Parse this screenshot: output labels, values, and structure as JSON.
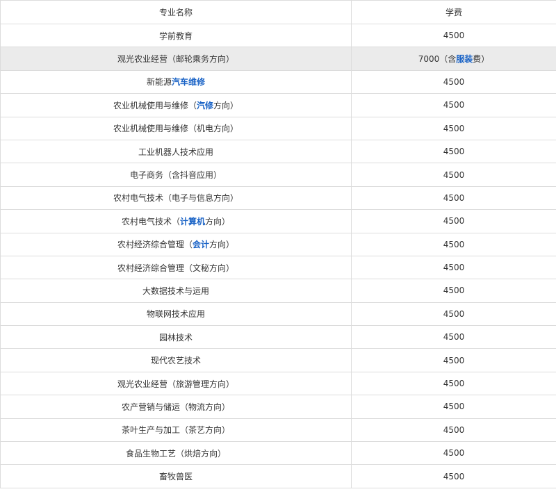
{
  "table": {
    "headers": {
      "major": "专业名称",
      "fee": "学费"
    },
    "rows": [
      {
        "major": [
          {
            "t": "学前教育"
          }
        ],
        "fee": [
          {
            "t": "4500"
          }
        ]
      },
      {
        "major": [
          {
            "t": "观光农业经营（邮轮乘务方向）"
          }
        ],
        "fee": [
          {
            "t": "7000（含"
          },
          {
            "t": "服装",
            "link": true
          },
          {
            "t": "费）"
          }
        ],
        "highlight": true
      },
      {
        "major": [
          {
            "t": "新能源"
          },
          {
            "t": "汽车维修",
            "link": true
          }
        ],
        "fee": [
          {
            "t": "4500"
          }
        ]
      },
      {
        "major": [
          {
            "t": "农业机械使用与维修（"
          },
          {
            "t": "汽修",
            "link": true
          },
          {
            "t": "方向）"
          }
        ],
        "fee": [
          {
            "t": "4500"
          }
        ]
      },
      {
        "major": [
          {
            "t": "农业机械使用与维修（机电方向）"
          }
        ],
        "fee": [
          {
            "t": "4500"
          }
        ]
      },
      {
        "major": [
          {
            "t": "工业机器人技术应用"
          }
        ],
        "fee": [
          {
            "t": "4500"
          }
        ]
      },
      {
        "major": [
          {
            "t": "电子商务（含抖音应用）"
          }
        ],
        "fee": [
          {
            "t": "4500"
          }
        ]
      },
      {
        "major": [
          {
            "t": "农村电气技术（电子与信息方向）"
          }
        ],
        "fee": [
          {
            "t": "4500"
          }
        ]
      },
      {
        "major": [
          {
            "t": "农村电气技术（"
          },
          {
            "t": "计算机",
            "link": true
          },
          {
            "t": "方向）"
          }
        ],
        "fee": [
          {
            "t": "4500"
          }
        ]
      },
      {
        "major": [
          {
            "t": "农村经济综合管理（"
          },
          {
            "t": "会计",
            "link": true
          },
          {
            "t": "方向）"
          }
        ],
        "fee": [
          {
            "t": "4500"
          }
        ]
      },
      {
        "major": [
          {
            "t": "农村经济综合管理（文秘方向）"
          }
        ],
        "fee": [
          {
            "t": "4500"
          }
        ]
      },
      {
        "major": [
          {
            "t": "大数据技术与运用"
          }
        ],
        "fee": [
          {
            "t": "4500"
          }
        ]
      },
      {
        "major": [
          {
            "t": "物联网技术应用"
          }
        ],
        "fee": [
          {
            "t": "4500"
          }
        ]
      },
      {
        "major": [
          {
            "t": "园林技术"
          }
        ],
        "fee": [
          {
            "t": "4500"
          }
        ]
      },
      {
        "major": [
          {
            "t": "现代农艺技术"
          }
        ],
        "fee": [
          {
            "t": "4500"
          }
        ]
      },
      {
        "major": [
          {
            "t": "观光农业经营（旅游管理方向）"
          }
        ],
        "fee": [
          {
            "t": "4500"
          }
        ]
      },
      {
        "major": [
          {
            "t": "农产营销与储运（物流方向）"
          }
        ],
        "fee": [
          {
            "t": "4500"
          }
        ]
      },
      {
        "major": [
          {
            "t": "茶叶生产与加工（茶艺方向）"
          }
        ],
        "fee": [
          {
            "t": "4500"
          }
        ]
      },
      {
        "major": [
          {
            "t": "食品生物工艺（烘焙方向）"
          }
        ],
        "fee": [
          {
            "t": "4500"
          }
        ]
      },
      {
        "major": [
          {
            "t": "畜牧兽医"
          }
        ],
        "fee": [
          {
            "t": "4500"
          }
        ]
      }
    ]
  },
  "colors": {
    "link": "#1a63c6",
    "border": "#dcdcdc",
    "highlight_row": "#ebebeb",
    "text": "#333333"
  }
}
